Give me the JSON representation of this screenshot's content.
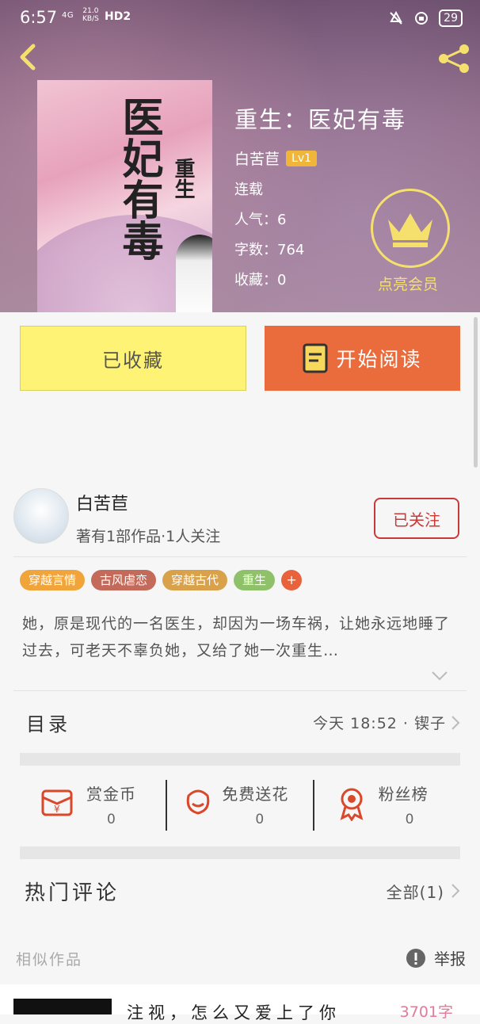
{
  "status_bar": {
    "time": "6:57",
    "network": "4G",
    "speed": "21.0",
    "speed_unit": "KB/S",
    "hd": "HD2",
    "battery": "29"
  },
  "book": {
    "title": "重生：医妃有毒",
    "cover_title": "医妃有毒",
    "cover_sub": "重生",
    "author": "白苦苣",
    "level": "Lv1",
    "status": "连载",
    "popularity": "人气：6",
    "word_count": "字数：764",
    "favorites": "收藏：0",
    "vip_label": "点亮会员"
  },
  "actions": {
    "collected_label": "已收藏",
    "read_label": "开始阅读"
  },
  "author_panel": {
    "name": "白苦苣",
    "subtitle": "著有1部作品·1人关注",
    "follow_label": "已关注"
  },
  "tags": [
    {
      "label": "穿越言情",
      "color": "#f0a43a"
    },
    {
      "label": "古风虐恋",
      "color": "#c46a5a"
    },
    {
      "label": "穿越古代",
      "color": "#d9a24a"
    },
    {
      "label": "重生",
      "color": "#8fc06a"
    }
  ],
  "tag_more": "+",
  "summary": "她，原是现代的一名医生，却因为一场车祸，让她永远地睡了过去，可老天不辜负她，又给了她一次重生…",
  "catalog": {
    "label": "目录",
    "update": "今天 18:52 · 锲子"
  },
  "stats": [
    {
      "label": "赏金币",
      "value": "0",
      "icon": "gift-card-icon"
    },
    {
      "label": "免费送花",
      "value": "0",
      "icon": "flower-icon"
    },
    {
      "label": "粉丝榜",
      "value": "0",
      "icon": "medal-icon"
    }
  ],
  "comments": {
    "label": "热门评论",
    "all": "全部(1)"
  },
  "similar_label": "相似作品",
  "report_label": "举报",
  "similar_item": {
    "title": "注视，怎么又爱上了你",
    "count": "3701字"
  }
}
